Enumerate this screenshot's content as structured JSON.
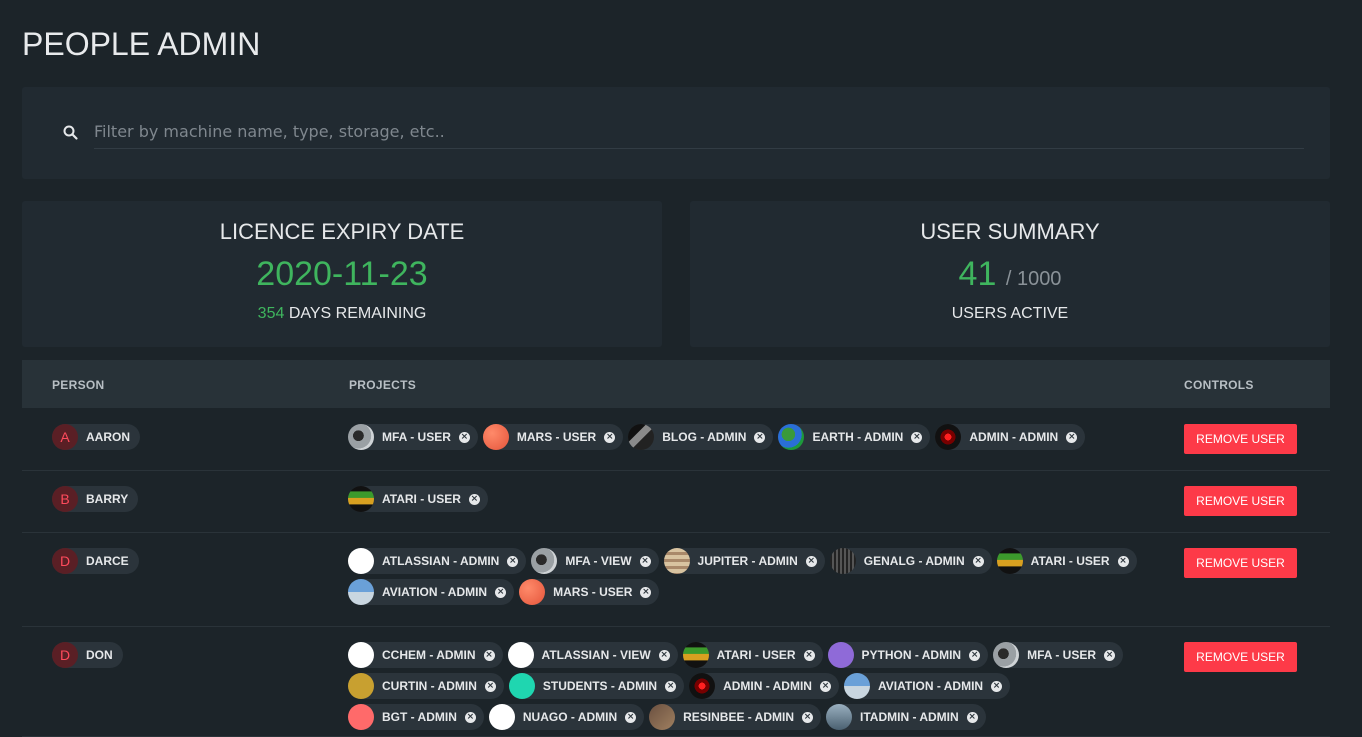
{
  "page": {
    "title": "PEOPLE ADMIN"
  },
  "search": {
    "placeholder": "Filter by machine name, type, storage, etc.."
  },
  "licence": {
    "title": "LICENCE EXPIRY DATE",
    "date": "2020-11-23",
    "days": "354",
    "days_label": "DAYS REMAINING"
  },
  "summary": {
    "title": "USER SUMMARY",
    "active": "41",
    "total": "/ 1000",
    "label": "USERS ACTIVE"
  },
  "table": {
    "headers": {
      "person": "PERSON",
      "projects": "PROJECTS",
      "controls": "CONTROLS"
    },
    "remove_label": "REMOVE USER",
    "rows": [
      {
        "initial": "A",
        "name": "AARON",
        "projects": [
          {
            "label": "MFA - USER",
            "icon": "mfa-icon"
          },
          {
            "label": "MARS - USER",
            "icon": "mars-icon"
          },
          {
            "label": "BLOG - ADMIN",
            "icon": "blog-icon"
          },
          {
            "label": "EARTH - ADMIN",
            "icon": "earth-icon"
          },
          {
            "label": "ADMIN - ADMIN",
            "icon": "admin-icon"
          }
        ]
      },
      {
        "initial": "B",
        "name": "BARRY",
        "projects": [
          {
            "label": "ATARI - USER",
            "icon": "atari-icon"
          }
        ]
      },
      {
        "initial": "D",
        "name": "DARCE",
        "projects": [
          {
            "label": "ATLASSIAN - ADMIN",
            "icon": "atlassian-icon"
          },
          {
            "label": "MFA - VIEW",
            "icon": "mfa-icon"
          },
          {
            "label": "JUPITER - ADMIN",
            "icon": "jupiter-icon"
          },
          {
            "label": "GENALG - ADMIN",
            "icon": "genalg-icon"
          },
          {
            "label": "ATARI - USER",
            "icon": "atari-icon"
          },
          {
            "label": "AVIATION - ADMIN",
            "icon": "aviation-icon"
          },
          {
            "label": "MARS - USER",
            "icon": "mars-icon"
          }
        ]
      },
      {
        "initial": "D",
        "name": "DON",
        "projects": [
          {
            "label": "CCHEM - ADMIN",
            "icon": "cchem-icon"
          },
          {
            "label": "ATLASSIAN - VIEW",
            "icon": "atlassian-icon"
          },
          {
            "label": "ATARI - USER",
            "icon": "atari-icon"
          },
          {
            "label": "PYTHON - ADMIN",
            "icon": "python-icon"
          },
          {
            "label": "MFA - USER",
            "icon": "mfa-icon"
          },
          {
            "label": "CURTIN - ADMIN",
            "icon": "curtin-icon"
          },
          {
            "label": "STUDENTS - ADMIN",
            "icon": "students-icon"
          },
          {
            "label": "ADMIN - ADMIN",
            "icon": "admin-icon"
          },
          {
            "label": "AVIATION - ADMIN",
            "icon": "aviation-icon"
          },
          {
            "label": "BGT - ADMIN",
            "icon": "bgt-icon"
          },
          {
            "label": "NUAGO - ADMIN",
            "icon": "nuago-icon"
          },
          {
            "label": "RESINBEE - ADMIN",
            "icon": "resinbee-icon"
          },
          {
            "label": "ITADMIN - ADMIN",
            "icon": "itadmin-icon"
          }
        ]
      }
    ]
  },
  "colors": {
    "accent_green": "#3fb55e",
    "danger": "#fd3a48",
    "background": "#1c2429",
    "card": "#212a31"
  }
}
